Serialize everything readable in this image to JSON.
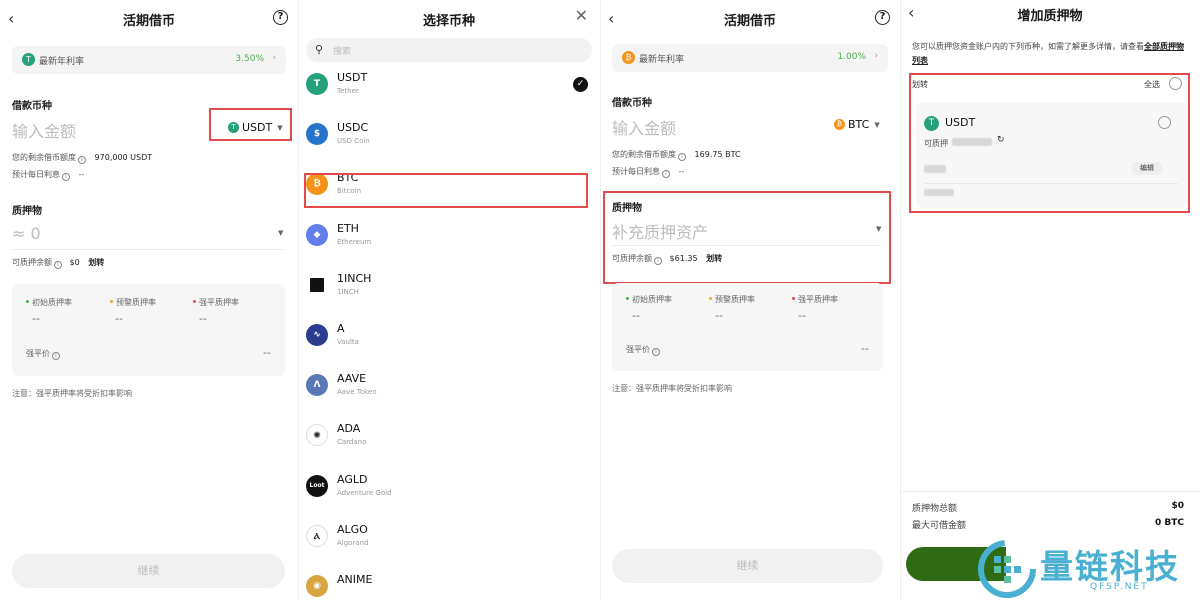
{
  "screen1": {
    "title": "活期借币",
    "rate_label": "最新年利率",
    "rate_value": "3.50%",
    "borrow_title": "借款币种",
    "amount_placeholder": "输入金额",
    "coin": "USDT",
    "remaining_label": "您的剩余借币额度",
    "remaining_value": "970,000 USDT",
    "daily_interest_label": "预计每日利息",
    "daily_interest_value": "--",
    "collateral_title": "质押物",
    "collateral_value": "≈ 0",
    "available_label": "可质押余额",
    "available_value": "$0",
    "transfer_link": "划转",
    "initial_ratio_label": "初始质押率",
    "initial_ratio_value": "--",
    "warning_ratio_label": "预警质押率",
    "warning_ratio_value": "--",
    "liquidation_ratio_label": "强平质押率",
    "liquidation_ratio_value": "--",
    "liquidation_price_label": "强平价",
    "liquidation_price_value": "--",
    "note": "注意：强平质押率将受折扣率影响",
    "continue": "继续"
  },
  "screen2": {
    "title": "选择币种",
    "search_placeholder": "搜索",
    "coins": [
      {
        "symbol": "USDT",
        "name": "Tether",
        "color": "#26a17b",
        "glyph": "T",
        "selected": true
      },
      {
        "symbol": "USDC",
        "name": "USD Coin",
        "color": "#2775ca",
        "glyph": "$"
      },
      {
        "symbol": "BTC",
        "name": "Bitcoin",
        "color": "#f7931a",
        "glyph": "₿"
      },
      {
        "symbol": "ETH",
        "name": "Ethereum",
        "color": "#627eea",
        "glyph": "◆"
      },
      {
        "symbol": "1INCH",
        "name": "1INCH",
        "color": "#111111",
        "glyph": ""
      },
      {
        "symbol": "A",
        "name": "Vaulta",
        "color": "#2a3d8f",
        "glyph": "∿"
      },
      {
        "symbol": "AAVE",
        "name": "Aave Token",
        "color": "#5a77b8",
        "glyph": "Λ"
      },
      {
        "symbol": "ADA",
        "name": "Cardano",
        "color": "#ffffff",
        "glyph": "✺"
      },
      {
        "symbol": "AGLD",
        "name": "Adventure Gold",
        "color": "#111111",
        "glyph": "Loot"
      },
      {
        "symbol": "ALGO",
        "name": "Algorand",
        "color": "#ffffff",
        "glyph": "Ⲁ"
      },
      {
        "symbol": "ANIME",
        "name": "",
        "color": "#d9a441",
        "glyph": "◉"
      }
    ]
  },
  "screen3": {
    "title": "活期借币",
    "rate_label": "最新年利率",
    "rate_value": "1.00%",
    "borrow_title": "借款币种",
    "amount_placeholder": "输入金额",
    "coin": "BTC",
    "remaining_label": "您的剩余借币额度",
    "remaining_value": "169.75 BTC",
    "daily_interest_label": "预计每日利息",
    "daily_interest_value": "--",
    "collateral_title": "质押物",
    "collateral_placeholder": "补充质押资产",
    "available_label": "可质押余额",
    "available_value": "$61.35",
    "transfer_link": "划转",
    "initial_ratio_label": "初始质押率",
    "initial_ratio_value": "--",
    "warning_ratio_label": "预警质押率",
    "warning_ratio_value": "--",
    "liquidation_ratio_label": "强平质押率",
    "liquidation_ratio_value": "--",
    "liquidation_price_label": "强平价",
    "liquidation_price_value": "--",
    "note": "注意：强平质押率将受折扣率影响",
    "continue": "继续"
  },
  "screen4": {
    "title": "增加质押物",
    "intro": "您可以质押您资金账户内的下列币种，如需了解更多详情，请查看",
    "intro_link": "全部质押物列表",
    "transfer": "划转",
    "select_all": "全选",
    "coin": "USDT",
    "pledgeable_label": "可质押",
    "edit": "编辑",
    "total_label": "质押物总额",
    "total_value": "$0",
    "max_borrow_label": "最大可借金额",
    "max_borrow_value": "0 BTC"
  },
  "watermark": {
    "text": "量链科技",
    "sub": "QFSP.NET"
  },
  "colors": {
    "highlight": "#e24b4b",
    "green": "#4caf50",
    "usdt": "#26a17b",
    "btc": "#f7931a",
    "watermark": "#4ab0d2"
  }
}
